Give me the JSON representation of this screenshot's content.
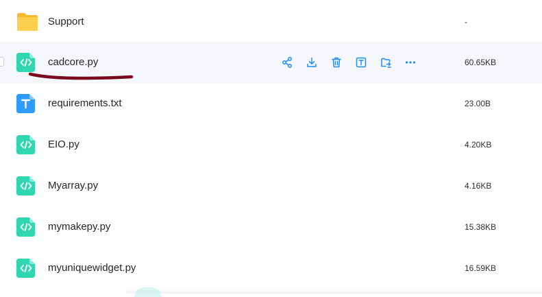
{
  "files": [
    {
      "name": "Support",
      "size": "-",
      "type": "folder",
      "icon": "folder-icon"
    },
    {
      "name": "cadcore.py",
      "size": "60.65KB",
      "type": "code",
      "icon": "code-file-icon",
      "hovered": true
    },
    {
      "name": "requirements.txt",
      "size": "23.00B",
      "type": "text",
      "icon": "text-file-icon"
    },
    {
      "name": "EIO.py",
      "size": "4.20KB",
      "type": "code",
      "icon": "code-file-icon"
    },
    {
      "name": "Myarray.py",
      "size": "4.16KB",
      "type": "code",
      "icon": "code-file-icon"
    },
    {
      "name": "mymakepy.py",
      "size": "15.38KB",
      "type": "code",
      "icon": "code-file-icon"
    },
    {
      "name": "myuniquewidget.py",
      "size": "16.59KB",
      "type": "code",
      "icon": "code-file-icon"
    }
  ],
  "row_actions": [
    "share-icon",
    "download-icon",
    "trash-icon",
    "rename-icon",
    "move-icon",
    "more-icon"
  ],
  "colors": {
    "folder": "#f8c43a",
    "code_file": "#2fd6b0",
    "text_file": "#2f9bff",
    "action_icon": "#1a8cff",
    "annotation_underline": "#7a0a1e",
    "hover_row": "#f5f7fb"
  }
}
